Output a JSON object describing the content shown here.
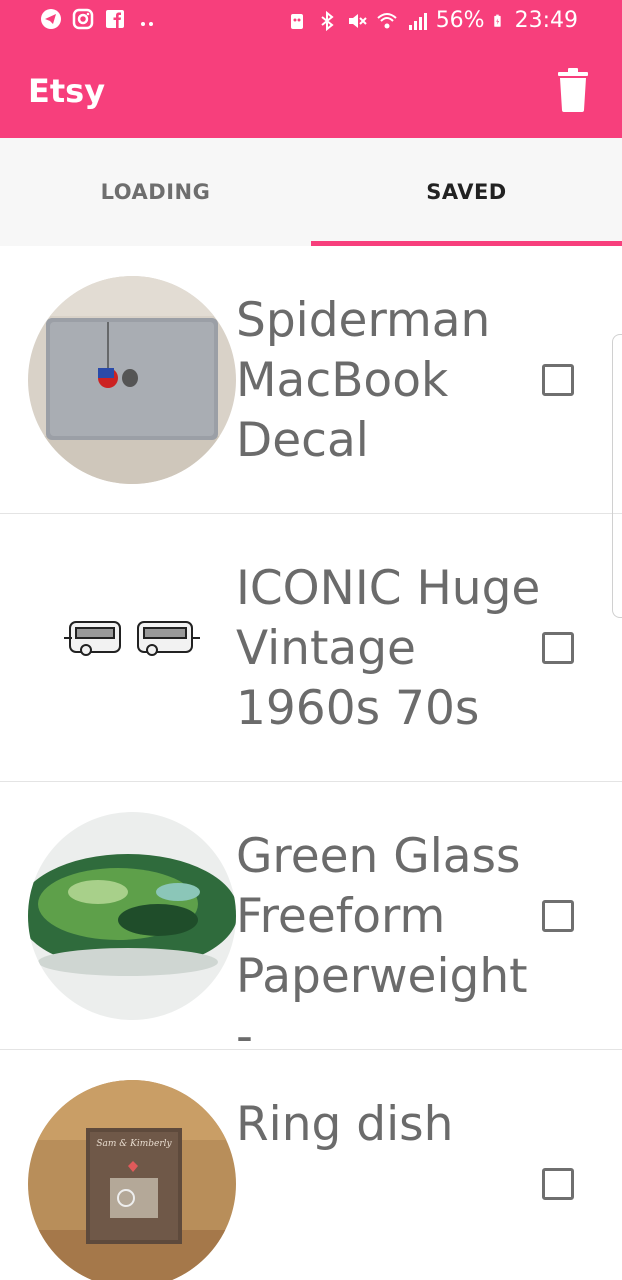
{
  "status_bar": {
    "battery": "56%",
    "time": "23:49",
    "left_icons": [
      "telegram-icon",
      "instagram-icon",
      "facebook-icon",
      "more-dots-icon"
    ],
    "right_icons": [
      "android-icon",
      "bluetooth-icon",
      "mute-icon",
      "wifi-icon",
      "signal-icon",
      "battery-icon"
    ]
  },
  "app_bar": {
    "title": "Etsy",
    "action_icon": "trash-icon"
  },
  "tabs": [
    {
      "label": "LOADING",
      "selected": false
    },
    {
      "label": "SAVED",
      "selected": true
    }
  ],
  "items": [
    {
      "title": "Spiderman MacBook Decal",
      "checked": false
    },
    {
      "title": "ICONIC Huge Vintage 1960s 70s",
      "checked": false
    },
    {
      "title": "Green Glass Freeform Paperweight -",
      "checked": false
    },
    {
      "title": "Ring dish",
      "checked": false,
      "image_text": "Sam & Kimberly"
    }
  ],
  "colors": {
    "accent": "#f73f7c",
    "tab_bg": "#f7f7f7",
    "text_gray": "#6b6b6b"
  }
}
